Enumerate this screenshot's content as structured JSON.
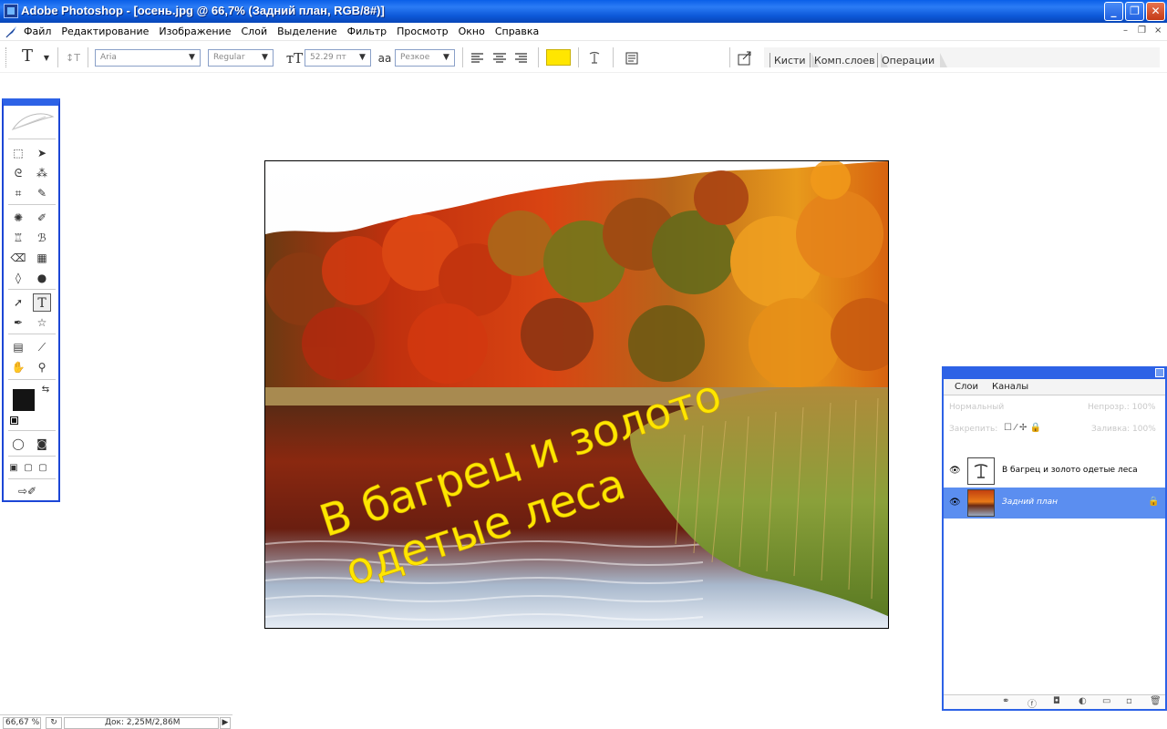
{
  "window": {
    "title": "Adobe Photoshop - [осень.jpg @ 66,7% (Задний план, RGB/8#)]",
    "minimize": "_",
    "maximize": "❐",
    "close": "✕"
  },
  "menubar": {
    "items": [
      "Файл",
      "Редактирование",
      "Изображение",
      "Слой",
      "Выделение",
      "Фильтр",
      "Просмотр",
      "Окно",
      "Справка"
    ],
    "doc_minimize": "–",
    "doc_restore": "❐",
    "doc_close": "×"
  },
  "options_bar": {
    "tool_glyph": "T",
    "font_family": "Aria",
    "font_style": "Regular",
    "font_size": "52.29 пт",
    "antialias_label": "aа",
    "antialias": "Резкое",
    "text_color": "#ffe600",
    "palette_wells": [
      "Кисти",
      "Комп.слоев",
      "Операции"
    ]
  },
  "canvas": {
    "text_line_1": "В багрец и золото",
    "text_line_2": "одетые леса",
    "text_color": "#ffe600"
  },
  "layers_panel": {
    "tabs": [
      "Слои",
      "Каналы"
    ],
    "blend_mode": "Нормальный",
    "opacity_label": "Непрозр.: 100%",
    "lock_label": "Закрепить:",
    "fill_label": "Заливка: 100%",
    "layers": [
      {
        "name": "В багрец и золото  одетые леса",
        "type": "text",
        "visible": true,
        "active": false
      },
      {
        "name": "Задний план",
        "type": "image",
        "visible": true,
        "active": true,
        "locked": true
      }
    ]
  },
  "status_bar": {
    "zoom": "66,67 %",
    "doc": "Док: 2,25M/2,86M"
  },
  "colors": {
    "title_bar": "#0a5fe8",
    "accent": "#2d62e6",
    "selected_layer": "#5b8ef0",
    "foreground": "#141414"
  }
}
